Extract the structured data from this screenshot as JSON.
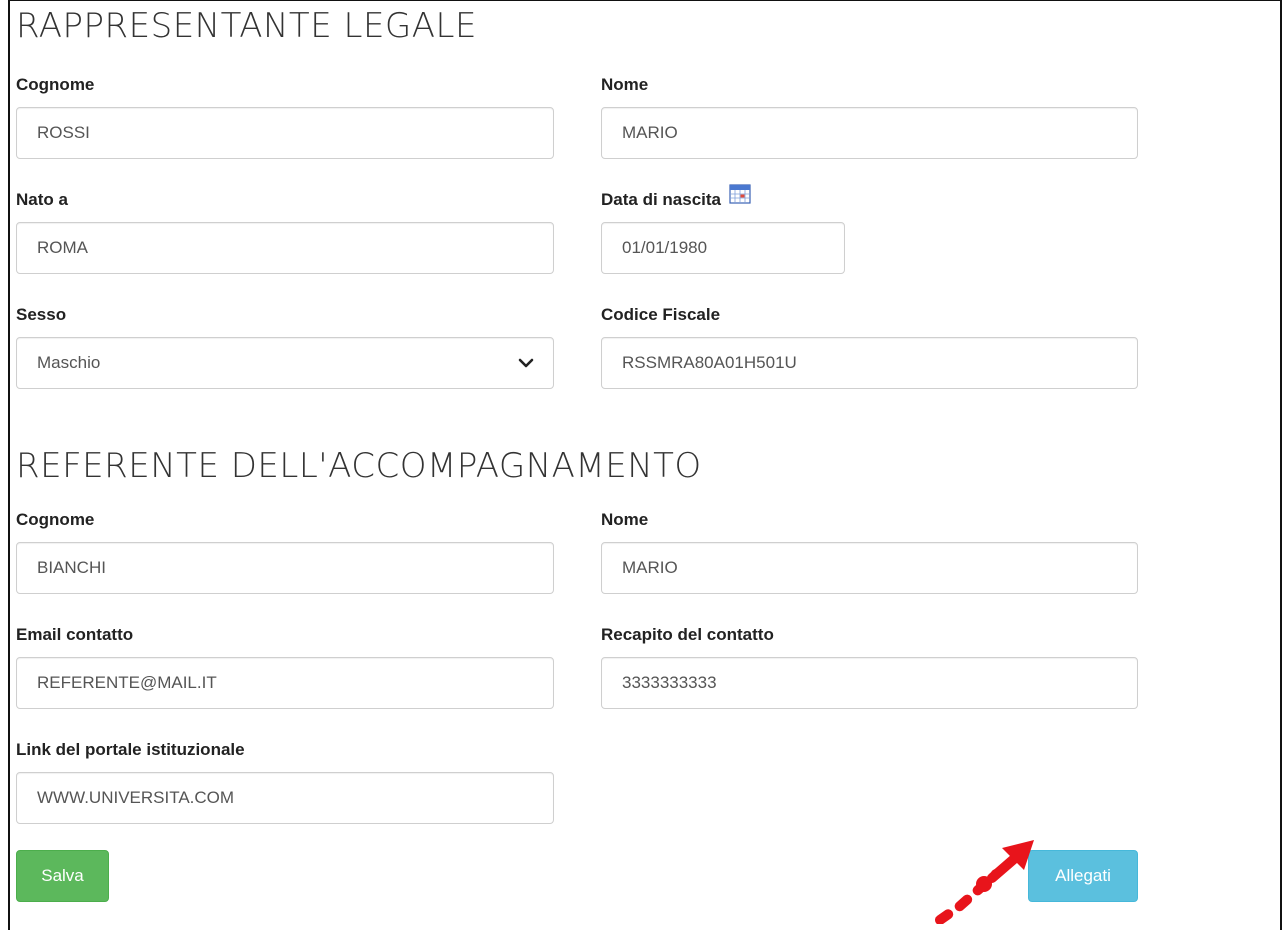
{
  "legale": {
    "title": "RAPPRESENTANTE LEGALE",
    "cognome_label": "Cognome",
    "cognome_value": "ROSSI",
    "nome_label": "Nome",
    "nome_value": "MARIO",
    "nato_label": "Nato a",
    "nato_value": "ROMA",
    "data_label": "Data di nascita",
    "data_value": "01/01/1980",
    "sesso_label": "Sesso",
    "sesso_value": "Maschio",
    "cf_label": "Codice Fiscale",
    "cf_value": "RSSMRA80A01H501U"
  },
  "referente": {
    "title": "REFERENTE DELL'ACCOMPAGNAMENTO",
    "cognome_label": "Cognome",
    "cognome_value": "BIANCHI",
    "nome_label": "Nome",
    "nome_value": "MARIO",
    "email_label": "Email contatto",
    "email_value": "REFERENTE@MAIL.IT",
    "recapito_label": "Recapito del contatto",
    "recapito_value": "3333333333",
    "link_label": "Link del portale istituzionale",
    "link_value": "WWW.UNIVERSITA.COM"
  },
  "buttons": {
    "save_label": "Salva",
    "attach_label": "Allegati"
  },
  "icons": {
    "calendar": "calendar-icon",
    "select_chevron": "chevron-down-icon",
    "annotation": "red-arrow-pointer"
  },
  "colors": {
    "save_button": "#5cb85c",
    "attach_button": "#5bc0de",
    "annotation_arrow": "#e8141b"
  }
}
